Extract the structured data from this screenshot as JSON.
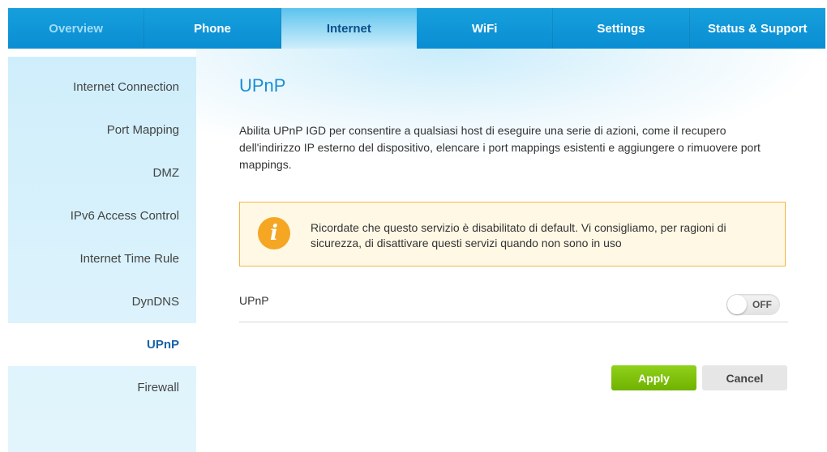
{
  "top_nav": {
    "tabs": [
      {
        "label": "Overview"
      },
      {
        "label": "Phone"
      },
      {
        "label": "Internet"
      },
      {
        "label": "WiFi"
      },
      {
        "label": "Settings"
      },
      {
        "label": "Status & Support"
      }
    ],
    "active": "Internet"
  },
  "sidebar": {
    "items": [
      {
        "label": "Internet Connection"
      },
      {
        "label": "Port Mapping"
      },
      {
        "label": "DMZ"
      },
      {
        "label": "IPv6 Access Control"
      },
      {
        "label": "Internet Time Rule"
      },
      {
        "label": "DynDNS"
      },
      {
        "label": "UPnP"
      },
      {
        "label": "Firewall"
      }
    ],
    "active": "UPnP"
  },
  "main": {
    "title": "UPnP",
    "description": "Abilita UPnP IGD per consentire a qualsiasi host di eseguire una serie di azioni, come il recupero dell'indirizzo IP esterno del dispositivo, elencare i port mappings esistenti e aggiungere o rimuovere port mappings.",
    "notice": {
      "icon": "info-icon",
      "text": "Ricordate che questo servizio è disabilitato di default. Vi consigliamo, per ragioni di sicurezza, di disattivare questi servizi quando non sono in uso"
    },
    "upnp_setting": {
      "label": "UPnP",
      "toggle_state": "OFF"
    },
    "buttons": {
      "apply": "Apply",
      "cancel": "Cancel"
    }
  },
  "colors": {
    "nav_blue": "#0a8ed3",
    "title_blue": "#1a8fd3",
    "apply_green": "#7ec20a",
    "notice_border": "#f5b547",
    "notice_icon": "#f5a623"
  }
}
